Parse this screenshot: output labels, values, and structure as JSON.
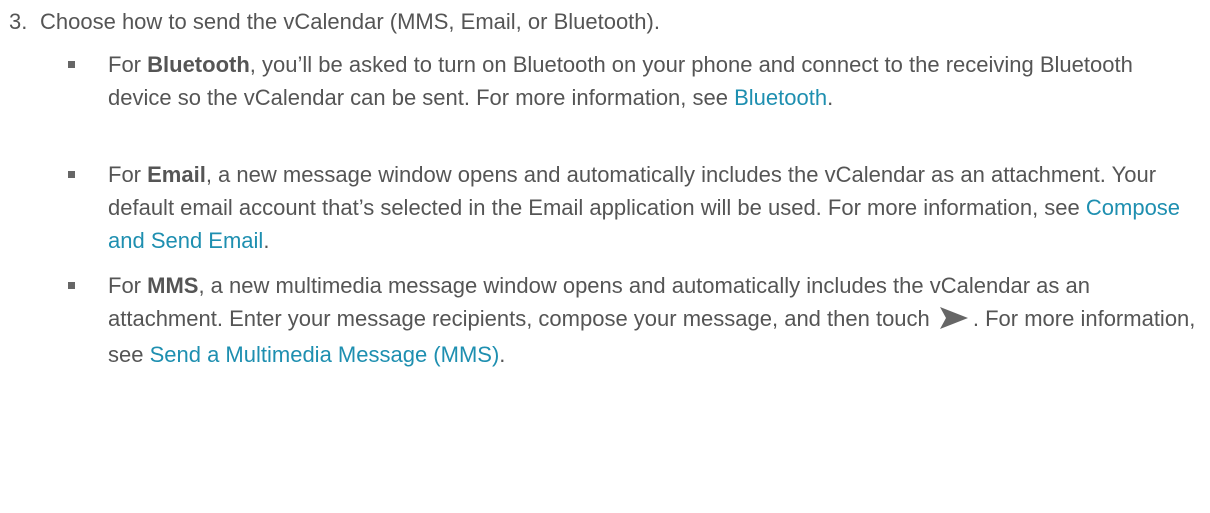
{
  "step": {
    "number": "3.",
    "text": "Choose how to send the vCalendar (MMS, Email, or Bluetooth)."
  },
  "bullets": [
    {
      "prefix": "For ",
      "bold": "Bluetooth",
      "text": ", you’ll be asked to turn on Bluetooth on your phone and connect to the receiving Bluetooth device so the vCalendar can be sent. For more information, see ",
      "link": "Bluetooth",
      "suffix": "."
    },
    {
      "prefix": "For ",
      "bold": "Email",
      "text": ", a new message window opens and automatically includes the vCalendar as an attachment. Your default email account that’s selected in the Email application will be used. For more information, see ",
      "link": "Compose and Send Email",
      "suffix": "."
    },
    {
      "prefix": "For ",
      "bold": "MMS",
      "text": ", a new multimedia message window opens and automatically includes the vCalendar as an attachment. Enter your message recipients, compose your message, and then touch ",
      "icon": "send-icon",
      "text_after_icon": ". For more information, see ",
      "link": "Send a Multimedia Message (MMS)",
      "suffix": "."
    }
  ],
  "colors": {
    "text": "#555555",
    "link": "#1e8fb0",
    "icon": "#666666"
  }
}
